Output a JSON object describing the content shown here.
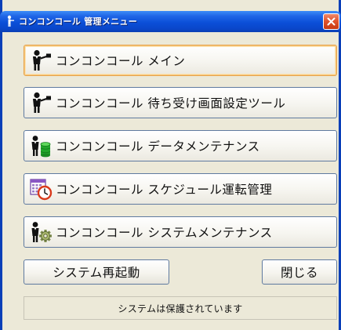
{
  "window": {
    "title": "コンコンコール 管理メニュー"
  },
  "menu": {
    "buttons": [
      {
        "label": "コンコンコール メイン",
        "icon": "person-icon"
      },
      {
        "label": "コンコンコール 待ち受け画面設定ツール",
        "icon": "person-icon"
      },
      {
        "label": "コンコンコール データメンテナンス",
        "icon": "person-database-icon"
      },
      {
        "label": "コンコンコール スケジュール運転管理",
        "icon": "calendar-clock-icon"
      },
      {
        "label": "コンコンコール システムメンテナンス",
        "icon": "person-gear-icon"
      }
    ]
  },
  "footer": {
    "restart_label": "システム再起動",
    "close_label": "閉じる"
  },
  "status": {
    "text": "システムは保護されています"
  },
  "colors": {
    "titlebar": "#0b4fd8",
    "window_bg": "#ece9d8",
    "close_button": "#e2552f",
    "focus_border": "#e8a24b"
  }
}
